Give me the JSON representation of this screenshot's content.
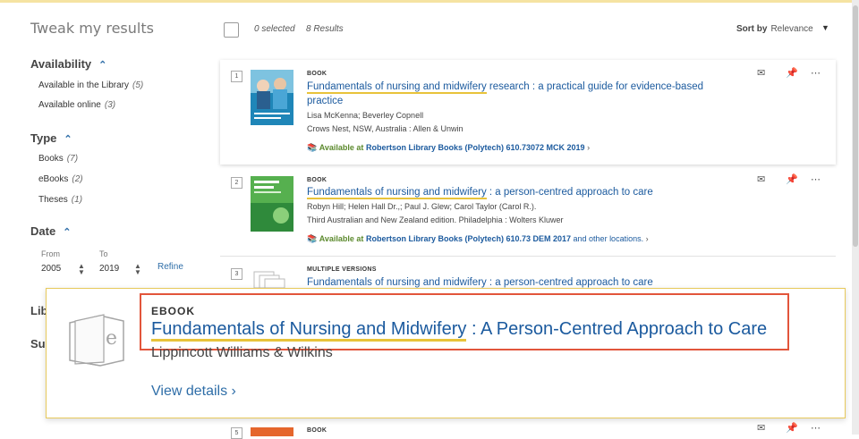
{
  "sidebar": {
    "title": "Tweak my results",
    "availability": {
      "heading": "Availability",
      "items": [
        {
          "label": "Available in the Library",
          "count": "(5)"
        },
        {
          "label": "Available online",
          "count": "(3)"
        }
      ]
    },
    "type": {
      "heading": "Type",
      "items": [
        {
          "label": "Books",
          "count": "(7)"
        },
        {
          "label": "eBooks",
          "count": "(2)"
        },
        {
          "label": "Theses",
          "count": "(1)"
        }
      ]
    },
    "date": {
      "heading": "Date",
      "from_label": "From",
      "to_label": "To",
      "from_value": "2005",
      "to_value": "2019",
      "refine_label": "Refine"
    },
    "clipped": [
      "Lib",
      "Su"
    ]
  },
  "results_header": {
    "selected": "0 selected",
    "count": "8 Results",
    "sort_label": "Sort by",
    "sort_value": "Relevance"
  },
  "results": [
    {
      "num": "1",
      "type": "BOOK",
      "title_highlight": "Fundamentals of nursing and midwifery",
      "title_rest": " research : a practical guide for evidence-based practice",
      "authors": "Lisa McKenna; Beverley Copnell",
      "publisher": "Crows Nest, NSW, Australia : Allen & Unwin",
      "avail_status": "Available at",
      "avail_location": "Robertson Library  Books (Polytech) 610.73072 MCK 2019",
      "avail_other": ""
    },
    {
      "num": "2",
      "type": "BOOK",
      "title_highlight": "Fundamentals of nursing and midwifery",
      "title_rest": " : a person-centred approach to care",
      "authors": "Robyn Hill; Helen Hall Dr.,; Paul J. Glew; Carol Taylor (Carol R.).",
      "publisher": "Third Australian and New Zealand edition. Philadelphia : Wolters Kluwer",
      "avail_status": "Available at",
      "avail_location": "Robertson Library  Books (Polytech) 610.73 DEM 2017",
      "avail_other": " and other locations."
    },
    {
      "num": "3",
      "type": "MULTIPLE VERSIONS",
      "title_highlight": "Fundamentals of nursing and midwifery",
      "title_rest": " : a person-centred approach to care"
    },
    {
      "num": "5",
      "type": "BOOK"
    }
  ],
  "popover": {
    "type": "EBOOK",
    "title_highlight": "Fundamentals of Nursing and Midwifery",
    "title_rest": " : A Person-Centred Approach to Care",
    "publisher": "Lippincott Williams & Wilkins",
    "link": "View details",
    "icon_letter": "e"
  },
  "colors": {
    "link": "#1b5a9e",
    "highlight_underline": "#e8c33a",
    "popover_outline": "#e2553b",
    "available": "#5c8a2e"
  }
}
